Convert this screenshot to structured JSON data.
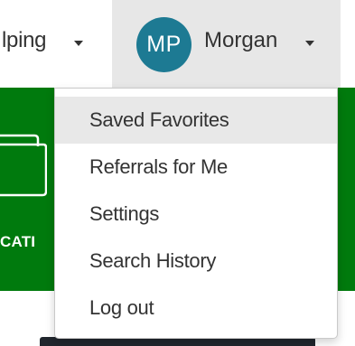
{
  "navbar": {
    "helping_label": "lping",
    "user_initials": "MP",
    "user_name": "Morgan",
    "avatar_color": "#1d7a93"
  },
  "banner": {
    "color": "#007a0d",
    "text": "CATI"
  },
  "user_menu": {
    "items": [
      {
        "label": "Saved Favorites",
        "active": true
      },
      {
        "label": "Referrals for Me",
        "active": false
      },
      {
        "label": "Settings",
        "active": false
      },
      {
        "label": "Search History",
        "active": false
      },
      {
        "label": "Log out",
        "active": false
      }
    ]
  }
}
